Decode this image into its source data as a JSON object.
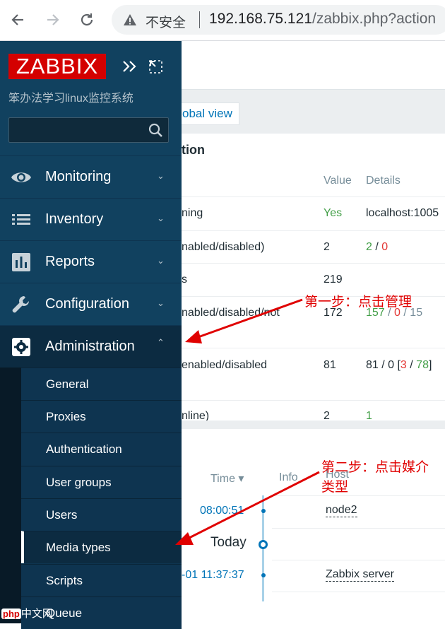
{
  "browser": {
    "insecure_label": "不安全",
    "url_host": "192.168.75.121",
    "url_rest": "/zabbix.php?action"
  },
  "main": {
    "global_view": "obal view",
    "widget1": {
      "title": "tion",
      "headers": {
        "value": "Value",
        "details": "Details"
      },
      "rows": [
        {
          "param": "ning",
          "value": "Yes",
          "details": "localhost:1005"
        },
        {
          "param": "nabled/disabled)",
          "value": "2",
          "d1": "2",
          "sep1": " / ",
          "d2": "0"
        },
        {
          "param": "s",
          "value": "219"
        },
        {
          "param": "nabled/disabled/not",
          "value": "172",
          "d1": "157",
          "sep1": " / ",
          "d2": "0",
          "sep2": " / ",
          "d3": "15"
        },
        {
          "param": "enabled/disabled",
          "value": "81",
          "d_pre": "81 / 0 [",
          "d1": "3",
          "sep1": " / ",
          "d2": "78",
          "d_post": "]"
        },
        {
          "param": "nline)",
          "value": "2",
          "d1": "1"
        }
      ]
    },
    "widget2": {
      "headers": {
        "time": "Time ▾",
        "info": "Info",
        "host": "Host"
      },
      "rows": [
        {
          "time": "08:00:51",
          "host": "node2"
        },
        {
          "time": "-01 11:37:37",
          "host": "Zabbix server"
        }
      ],
      "today": "Today"
    }
  },
  "sidebar": {
    "logo": "ZABBIX",
    "server_name": "笨办法学习linux监控系统",
    "menu": [
      {
        "label": "Monitoring",
        "icon": "eye-icon"
      },
      {
        "label": "Inventory",
        "icon": "list-icon"
      },
      {
        "label": "Reports",
        "icon": "bar-chart-icon"
      },
      {
        "label": "Configuration",
        "icon": "wrench-icon"
      },
      {
        "label": "Administration",
        "icon": "gear-icon"
      }
    ],
    "submenu": [
      "General",
      "Proxies",
      "Authentication",
      "User groups",
      "Users",
      "Media types",
      "Scripts",
      "Queue"
    ]
  },
  "annotations": {
    "step1": "第一步：点击管理",
    "step2_line1": "第二步：点击媒介",
    "step2_line2": "类型"
  },
  "watermark": {
    "badge": "php",
    "text": "中文网"
  },
  "colors": {
    "sidebar": "#0e3450",
    "logo": "#d40000",
    "link": "#0275b8",
    "annotation": "#e00000"
  }
}
